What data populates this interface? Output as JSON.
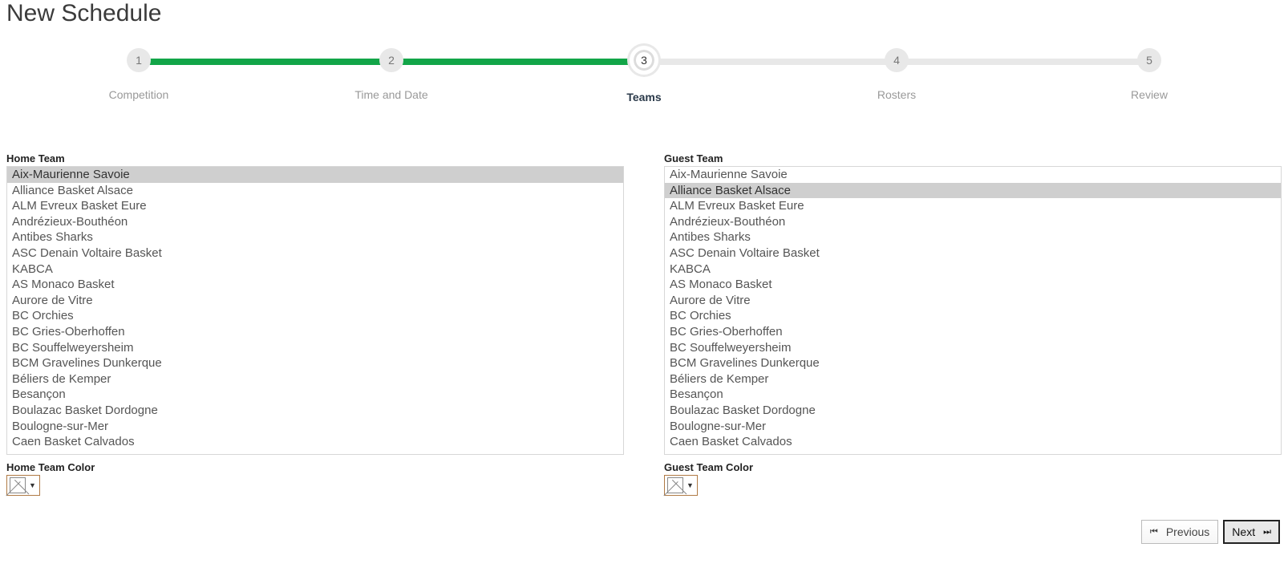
{
  "page": {
    "title": "New Schedule"
  },
  "stepper": {
    "steps": [
      {
        "num": "1",
        "label": "Competition"
      },
      {
        "num": "2",
        "label": "Time and Date"
      },
      {
        "num": "3",
        "label": "Teams"
      },
      {
        "num": "4",
        "label": "Rosters"
      },
      {
        "num": "5",
        "label": "Review"
      }
    ],
    "active_index": 2
  },
  "home": {
    "label": "Home Team",
    "color_label": "Home Team Color",
    "selected_index": 0,
    "teams": [
      "Aix-Maurienne Savoie",
      "Alliance Basket Alsace",
      "ALM Evreux Basket Eure",
      "Andrézieux-Bouthéon",
      "Antibes Sharks",
      "ASC Denain Voltaire Basket",
      "KABCA",
      "AS Monaco Basket",
      "Aurore de Vitre",
      "BC Orchies",
      "BC Gries-Oberhoffen",
      "BC Souffelweyersheim",
      "BCM Gravelines Dunkerque",
      "Béliers de Kemper",
      "Besançon",
      "Boulazac Basket Dordogne",
      "Boulogne-sur-Mer",
      "Caen Basket Calvados"
    ]
  },
  "guest": {
    "label": "Guest Team",
    "color_label": "Guest Team Color",
    "selected_index": 1,
    "teams": [
      "Aix-Maurienne Savoie",
      "Alliance Basket Alsace",
      "ALM Evreux Basket Eure",
      "Andrézieux-Bouthéon",
      "Antibes Sharks",
      "ASC Denain Voltaire Basket",
      "KABCA",
      "AS Monaco Basket",
      "Aurore de Vitre",
      "BC Orchies",
      "BC Gries-Oberhoffen",
      "BC Souffelweyersheim",
      "BCM Gravelines Dunkerque",
      "Béliers de Kemper",
      "Besançon",
      "Boulazac Basket Dordogne",
      "Boulogne-sur-Mer",
      "Caen Basket Calvados"
    ]
  },
  "footer": {
    "previous": "Previous",
    "next": "Next"
  }
}
